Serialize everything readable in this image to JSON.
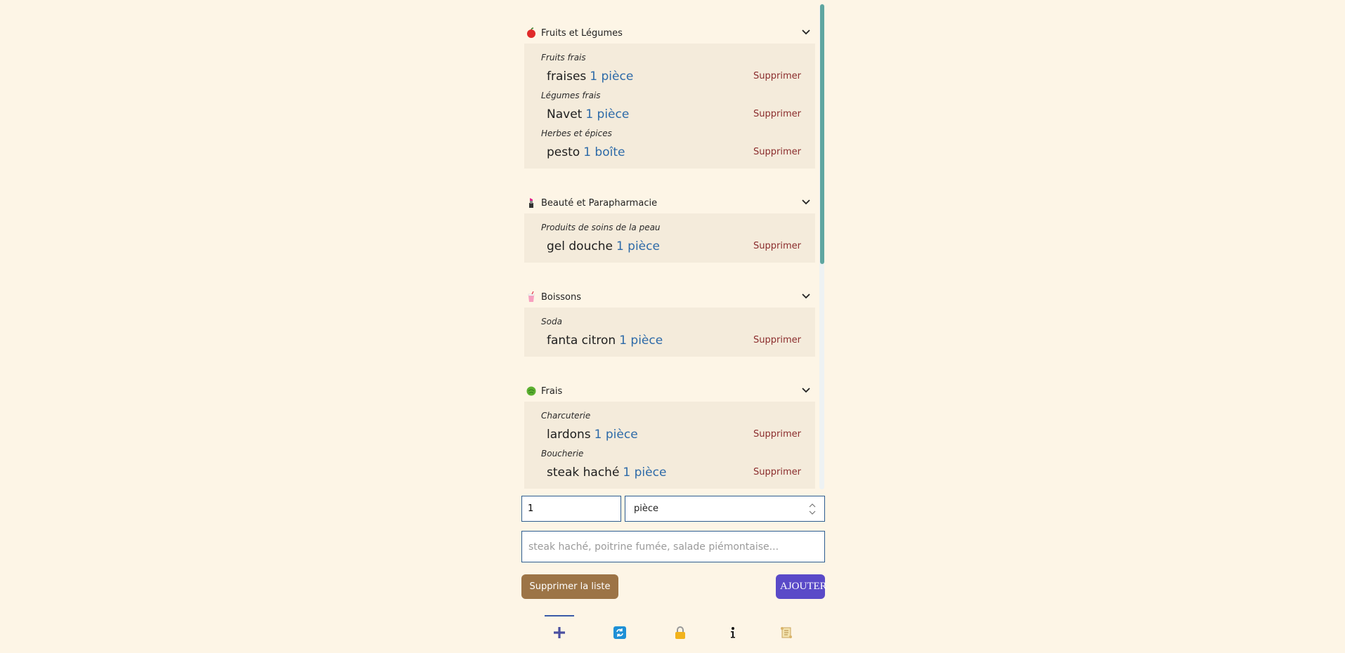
{
  "categories": [
    {
      "icon": "apple-icon",
      "title": "Fruits et Légumes",
      "groups": [
        {
          "name": "Fruits frais",
          "items": [
            {
              "name": "fraises",
              "qty": "1 pièce"
            }
          ]
        },
        {
          "name": "Légumes frais",
          "items": [
            {
              "name": "Navet",
              "qty": "1 pièce"
            }
          ]
        },
        {
          "name": "Herbes et épices",
          "items": [
            {
              "name": "pesto",
              "qty": "1 boîte"
            }
          ]
        }
      ]
    },
    {
      "icon": "lipstick-icon",
      "title": "Beauté et Parapharmacie",
      "groups": [
        {
          "name": "Produits de soins de la peau",
          "items": [
            {
              "name": "gel douche",
              "qty": "1 pièce"
            }
          ]
        }
      ]
    },
    {
      "icon": "cup-with-straw-icon",
      "title": "Boissons",
      "groups": [
        {
          "name": "Soda",
          "items": [
            {
              "name": "fanta citron",
              "qty": "1 pièce"
            }
          ]
        }
      ]
    },
    {
      "icon": "lettuce-icon",
      "title": "Frais",
      "groups": [
        {
          "name": "Charcuterie",
          "items": [
            {
              "name": "lardons",
              "qty": "1 pièce"
            }
          ]
        },
        {
          "name": "Boucherie",
          "items": [
            {
              "name": "steak haché",
              "qty": "1 pièce"
            }
          ]
        }
      ]
    }
  ],
  "delete_label": "Supprimer",
  "form": {
    "quantity_value": "1",
    "unit_value": "pièce",
    "product_placeholder": "steak haché, poitrine fumée, salade piémontaise...",
    "clear_label": "Supprimer la liste",
    "add_label": "AJOUTER"
  },
  "nav": [
    "plus-icon",
    "sync-icon",
    "lock-icon",
    "info-icon",
    "scroll-icon"
  ],
  "colors": {
    "background": "#fdf5e6",
    "category_panel": "#f4ebdb",
    "quantity_text": "#2d6aa8",
    "delete_text": "#8b2d2d",
    "clear_button": "#9c7446",
    "add_button": "#5a4ac8",
    "scrollbar_thumb": "#5fa6a0"
  }
}
